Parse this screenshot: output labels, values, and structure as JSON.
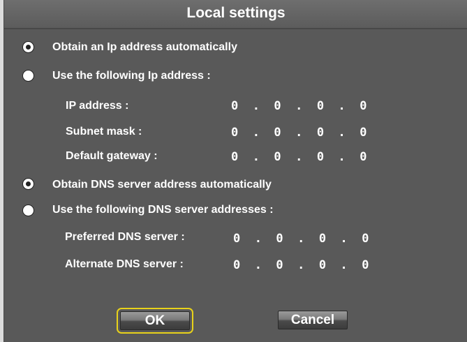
{
  "dialog": {
    "title": "Local settings",
    "ip_auto_label": "Obtain an Ip address automatically",
    "ip_manual_label": "Use the following Ip address :",
    "ip_auto_selected": true,
    "ip_fields": [
      {
        "label": "IP address :",
        "value": "0  .  0  .  0  .  0"
      },
      {
        "label": "Subnet mask :",
        "value": "0  .  0  .  0  .  0"
      },
      {
        "label": "Default gateway :",
        "value": "0  .  0  .  0  .  0"
      }
    ],
    "dns_auto_label": "Obtain DNS server address automatically",
    "dns_manual_label": "Use the following DNS server addresses :",
    "dns_auto_selected": true,
    "dns_fields": [
      {
        "label": "Preferred DNS server :",
        "value": "0  .  0  .  0  .  0"
      },
      {
        "label": "Alternate  DNS server :",
        "value": "0  .  0  .  0  .  0"
      }
    ],
    "ok_label": "OK",
    "cancel_label": "Cancel"
  }
}
